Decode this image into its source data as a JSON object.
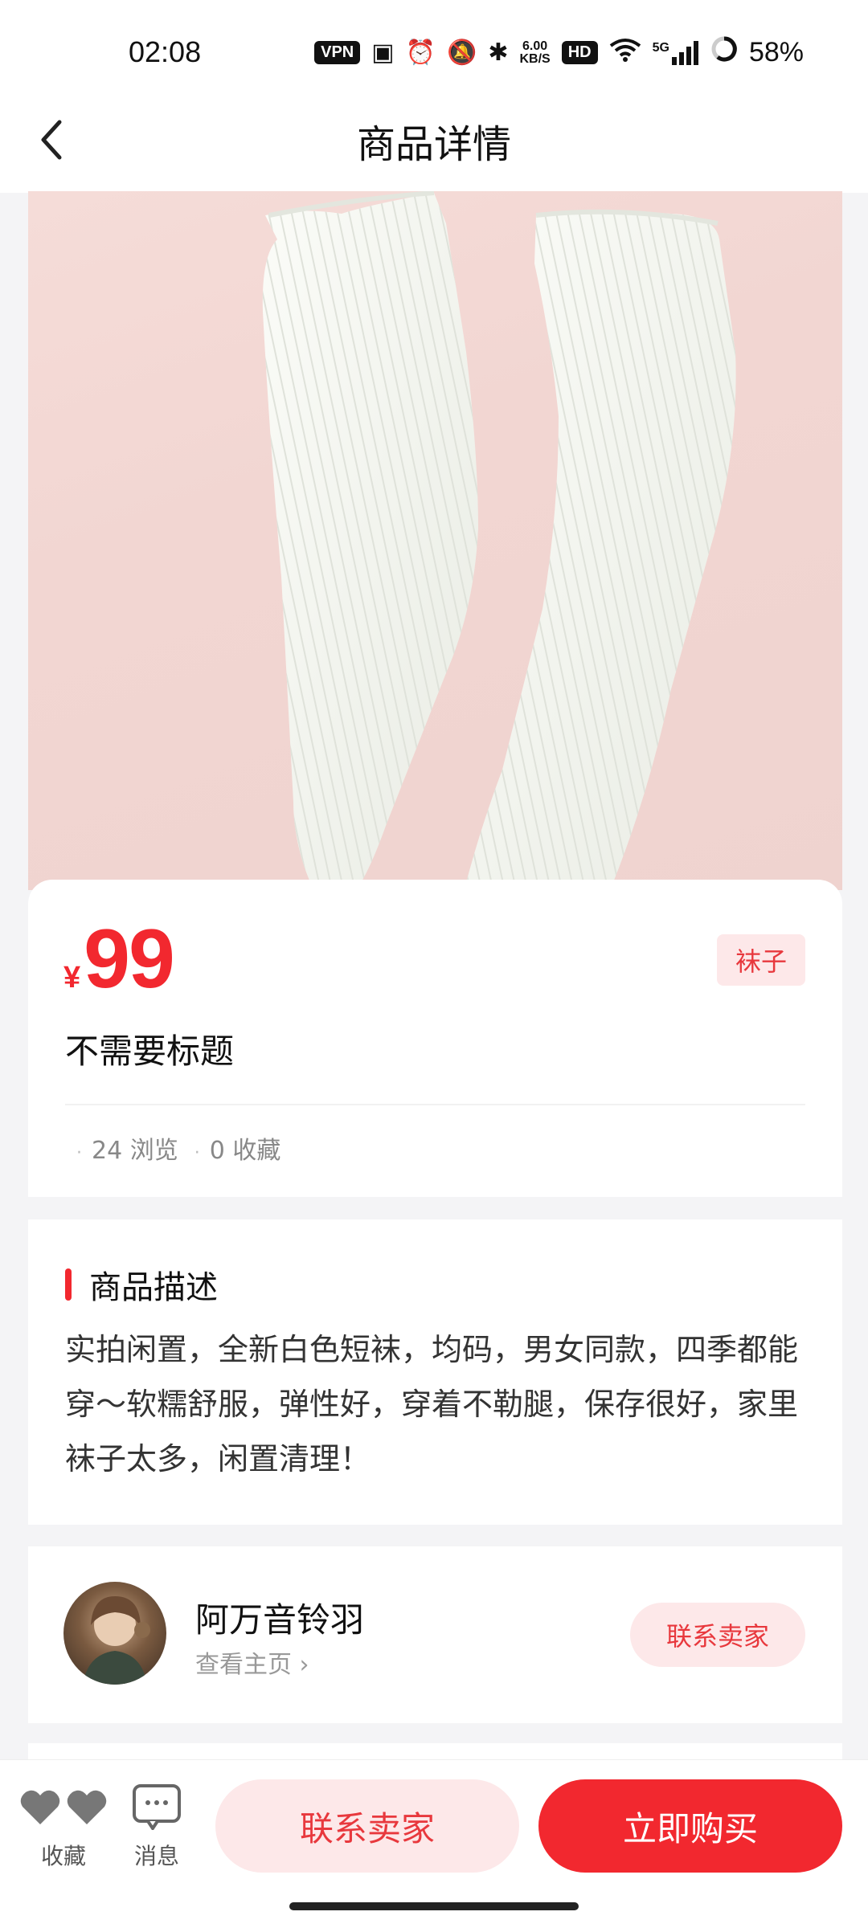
{
  "status_bar": {
    "time": "02:08",
    "vpn_badge": "VPN",
    "speed_value": "6.00",
    "speed_unit": "KB/S",
    "hd_badge": "HD",
    "network": "5G",
    "battery": "58%"
  },
  "nav": {
    "title": "商品详情"
  },
  "product": {
    "currency": "¥",
    "price": "99",
    "category_tag": "袜子",
    "title": "不需要标题",
    "views": "24 浏览",
    "favorites": "0 收藏"
  },
  "description": {
    "section_title": "商品描述",
    "text": "实拍闲置，全新白色短袜，均码，男女同款，四季都能穿～软糯舒服，弹性好，穿着不勒腿，保存很好，家里袜子太多，闲置清理！"
  },
  "seller": {
    "name": "阿万音铃羽",
    "profile_link": "查看主页 ›",
    "contact_label": "联系卖家"
  },
  "bottom_bar": {
    "favorite_label": "收藏",
    "message_label": "消息",
    "contact_label": "联系卖家",
    "buy_label": "立即购买"
  },
  "colors": {
    "accent": "#f2282f",
    "accent_light": "#fde8e9"
  }
}
